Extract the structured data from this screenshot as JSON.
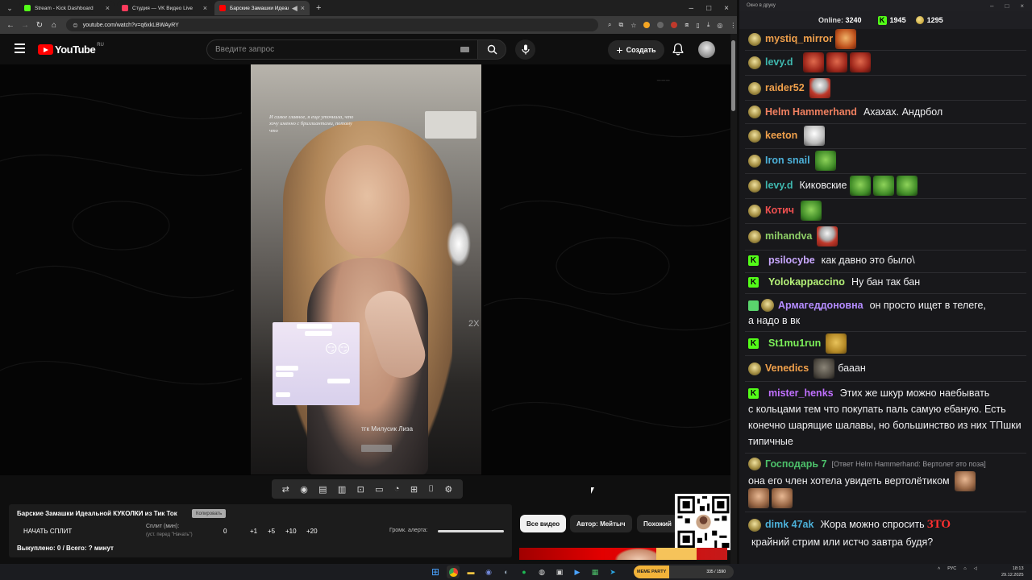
{
  "browser": {
    "tabs": [
      {
        "title": "Stream - Kick Dashboard",
        "color": "#53fc18",
        "active": false
      },
      {
        "title": "Студия — VK Видео Live",
        "color": "#ff3b5c",
        "active": false
      },
      {
        "title": "Барские Замашки Идеаль",
        "color": "#ff0000",
        "active": true
      }
    ],
    "url": "youtube.com/watch?v=q6xkLBWAyRY"
  },
  "youtube": {
    "logo_text": "YouTube",
    "country_code": "RU",
    "search_placeholder": "Введите запрос",
    "create_label": "Создать"
  },
  "player": {
    "caption": "И самое главное, я еще уточнила, что хочу именно с бриллиантами, потому что",
    "chat_emoji": "😏😏",
    "tgk_text": "тгк Милусик Лиза",
    "speed": "2X"
  },
  "split_panel": {
    "video_title": "Барские Замашки Идеальной КУКОЛКИ из Тик Ток",
    "copy_label": "Копировать",
    "start_label": "НАЧАТЬ СПЛИТ",
    "split_label": "Сплит (мин):",
    "split_hint": "(уст. перед \"Начать\")",
    "value": "0",
    "increments": [
      "+1",
      "+5",
      "+10",
      "+20"
    ],
    "volume_label": "Громк. алерта:",
    "volume_value": 1.0,
    "done_text": "Выкуплено: 0 / Всего: ? минут"
  },
  "chips": {
    "all": "Все видео",
    "author": "Автор: Мейтыч",
    "similar": "Похожий"
  },
  "chat": {
    "window_title": "Окно в друку",
    "online_label": "Online:",
    "online_value": "3240",
    "kick_count": "1945",
    "coin_count": "1295",
    "messages": [
      {
        "name": "mystiq_mirror",
        "color": "#f0a04b",
        "text": ""
      },
      {
        "name": "levy.d",
        "color": "#3fb8af",
        "text": ""
      },
      {
        "name": "raider52",
        "color": "#f0a04b",
        "text": ""
      },
      {
        "name": "Helm Hammerhand",
        "color": "#f08060",
        "text": "Ахахах. Андрбол"
      },
      {
        "name": "keeton",
        "color": "#f0a04b",
        "text": ""
      },
      {
        "name": "Iron snail",
        "color": "#4cb0d8",
        "text": ""
      },
      {
        "name": "levy.d",
        "color": "#3fb8af",
        "text": "Киковские"
      },
      {
        "name": "Котич",
        "color": "#f05050",
        "text": ""
      },
      {
        "name": "mihandva",
        "color": "#8fd068",
        "text": ""
      },
      {
        "name": "psilocybe",
        "color": "#c9a8ff",
        "text": "как давно это было\\"
      },
      {
        "name": "Yolokappaccino",
        "color": "#b4f078",
        "text": "Ну бан так бан"
      },
      {
        "name": "Армагеддоновна",
        "color": "#b48cff",
        "text": "он просто ищет в телеге,",
        "cont": "а надо в вк"
      },
      {
        "name": "St1mu1run",
        "color": "#7cf05a",
        "text": ""
      },
      {
        "name": "Venedics",
        "color": "#f0a04b",
        "text": "бааан"
      },
      {
        "name": "mister_henks",
        "color": "#c070ff",
        "text": "Этих же шкур можно наебывать",
        "cont": "с кольцами тем что покупать паль самую ебаную. Есть конечно шарящие шалавы, но большинство из них ТПшки типичные"
      },
      {
        "name": "Господарь 7",
        "color": "#4cc06a",
        "reply": "[Ответ Helm Hammerhand: Вертолет это поза]",
        "cont": "она его член хотела увидеть вертолётиком"
      },
      {
        "name": "dimk 47ak",
        "color": "#4cb0d8",
        "text": "Жора можно спросить",
        "emote_text": "ЗТО",
        "cont": "крайний стрим или истчо завтра будя?"
      }
    ]
  },
  "taskbar": {
    "pill_label": "MEME PARTY",
    "pill_value": "335 / 1590",
    "lang": "РУС",
    "time": "18:13",
    "date": "29.12.2025"
  }
}
